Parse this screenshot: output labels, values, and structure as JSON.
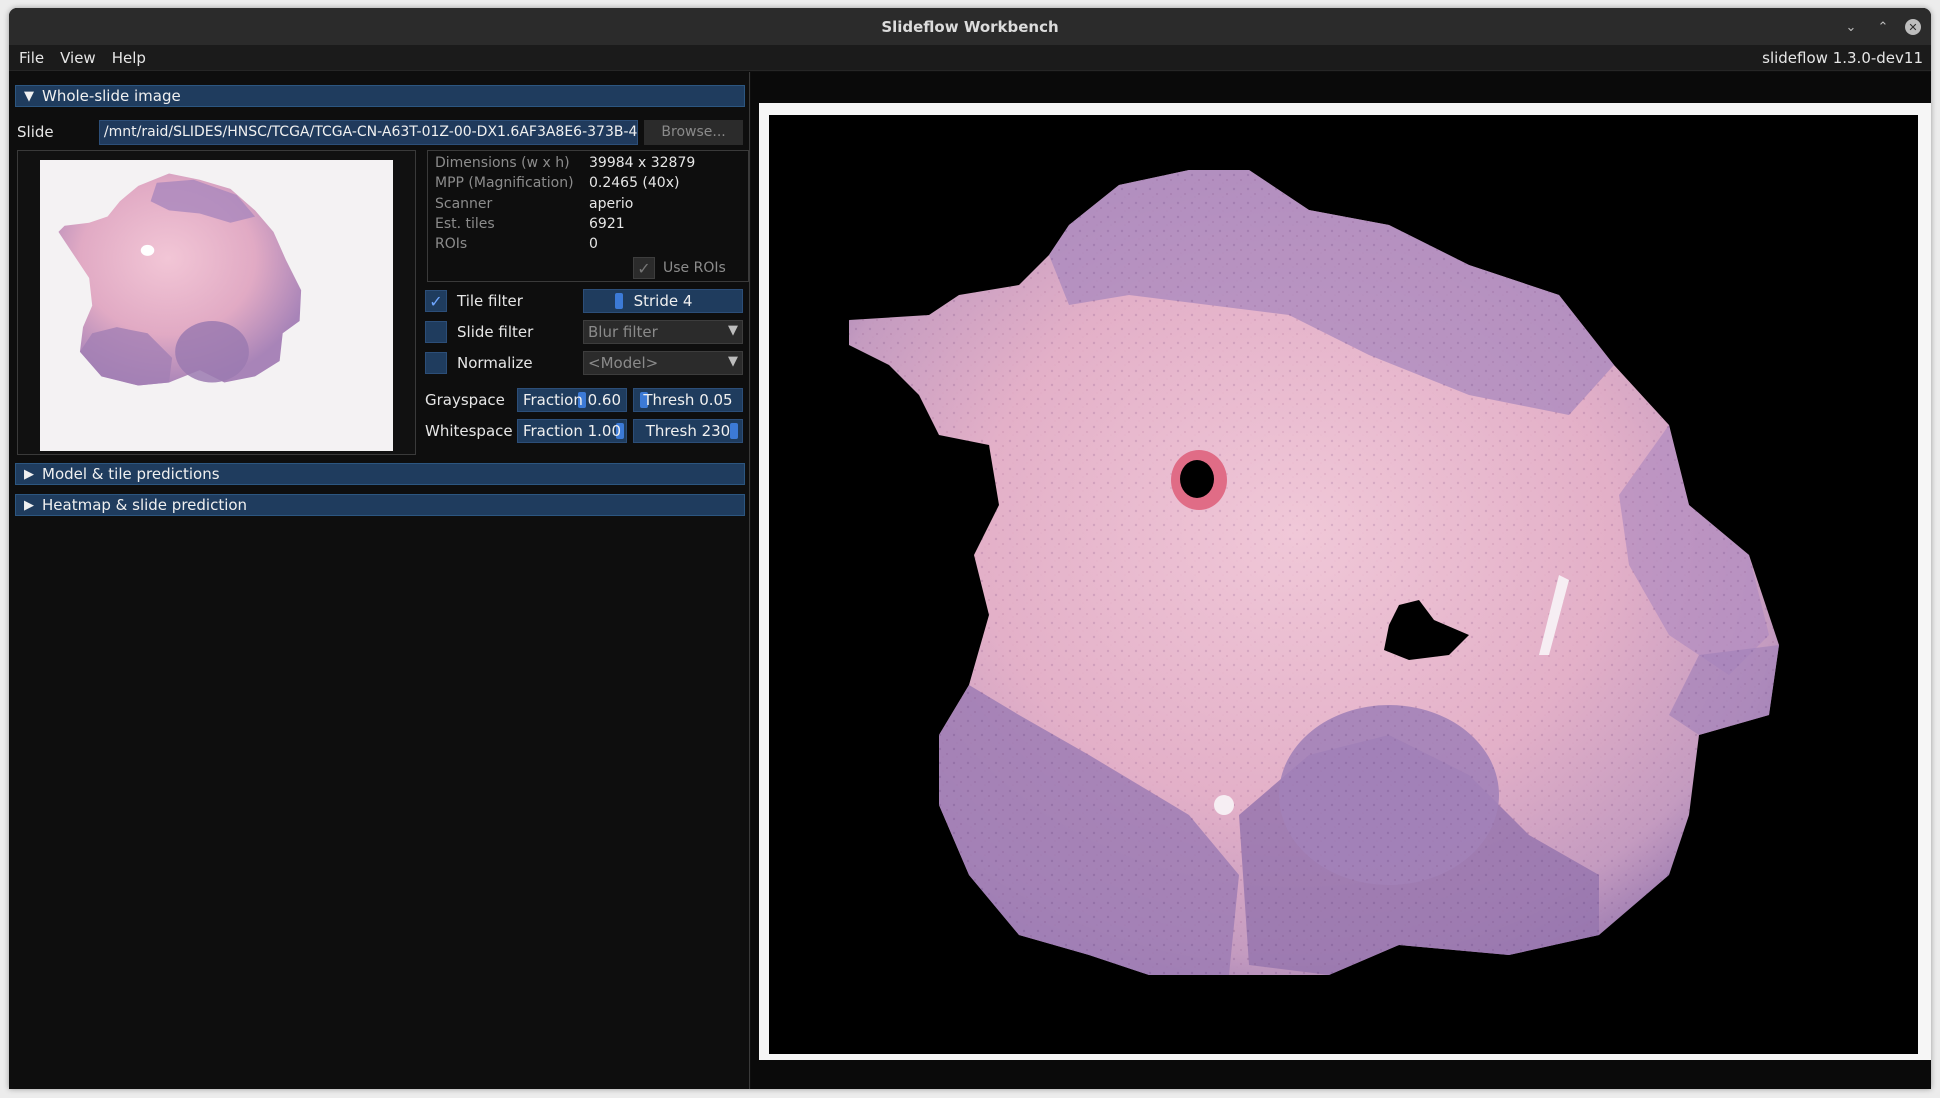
{
  "window": {
    "title": "Slideflow Workbench"
  },
  "menubar": {
    "items": [
      "File",
      "View",
      "Help"
    ],
    "version": "slideflow 1.3.0-dev11"
  },
  "sections": {
    "wsi": "Whole-slide image",
    "model": "Model & tile predictions",
    "heatmap": "Heatmap & slide prediction"
  },
  "slide": {
    "label": "Slide",
    "path": "/mnt/raid/SLIDES/HNSC/TCGA/TCGA-CN-A63T-01Z-00-DX1.6AF3A8E6-373B-4",
    "browse": "Browse..."
  },
  "info": [
    {
      "key": "Dimensions (w x h)",
      "value": "39984 x 32879"
    },
    {
      "key": "MPP (Magnification)",
      "value": "0.2465 (40x)"
    },
    {
      "key": "Scanner",
      "value": "aperio"
    },
    {
      "key": "Est. tiles",
      "value": "6921"
    },
    {
      "key": "ROIs",
      "value": "0"
    }
  ],
  "use_rois": {
    "label": "Use ROIs",
    "checked": true
  },
  "filters": {
    "tile_filter": {
      "label": "Tile filter",
      "checked": true,
      "slider": "Stride 4",
      "slider_value": 4
    },
    "slide_filter": {
      "label": "Slide filter",
      "checked": false,
      "combo": "Blur filter"
    },
    "normalize": {
      "label": "Normalize",
      "checked": false,
      "combo": "<Model>"
    }
  },
  "grayspace": {
    "label": "Grayspace",
    "fraction": "Fraction 0.60",
    "fraction_value": 0.6,
    "thresh": "Thresh 0.05",
    "thresh_value": 0.05
  },
  "whitespace": {
    "label": "Whitespace",
    "fraction": "Fraction 1.00",
    "fraction_value": 1.0,
    "thresh": "Thresh 230",
    "thresh_value": 230
  },
  "colors": {
    "accent": "#1f3c5e",
    "grab": "#3c7ad6",
    "tissue": "#d9a9c4",
    "tissue_dark": "#9a7ab0"
  }
}
